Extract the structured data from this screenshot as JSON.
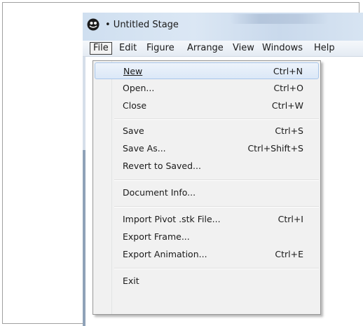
{
  "window": {
    "title": "• Untitled Stage",
    "app_icon": "pivot-stickfigure-icon"
  },
  "menu_bar": {
    "items": [
      {
        "label": "File",
        "active": true
      },
      {
        "label": "Edit"
      },
      {
        "label": "Figure"
      },
      {
        "label": "Arrange"
      },
      {
        "label": "View"
      },
      {
        "label": "Windows"
      },
      {
        "label": "Help"
      }
    ]
  },
  "file_menu": {
    "items": [
      {
        "label": "New",
        "shortcut": "Ctrl+N",
        "highlighted": true
      },
      {
        "label": "Open...",
        "shortcut": "Ctrl+O"
      },
      {
        "label": "Close",
        "shortcut": "Ctrl+W"
      },
      {
        "label": "Save",
        "shortcut": "Ctrl+S"
      },
      {
        "label": "Save As...",
        "shortcut": "Ctrl+Shift+S"
      },
      {
        "label": "Revert to Saved...",
        "shortcut": ""
      },
      {
        "label": "Document Info...",
        "shortcut": ""
      },
      {
        "label": "Import Pivot .stk File...",
        "shortcut": "Ctrl+I"
      },
      {
        "label": "Export Frame...",
        "shortcut": ""
      },
      {
        "label": "Export Animation...",
        "shortcut": "Ctrl+E"
      },
      {
        "label": "Exit",
        "shortcut": ""
      }
    ]
  }
}
